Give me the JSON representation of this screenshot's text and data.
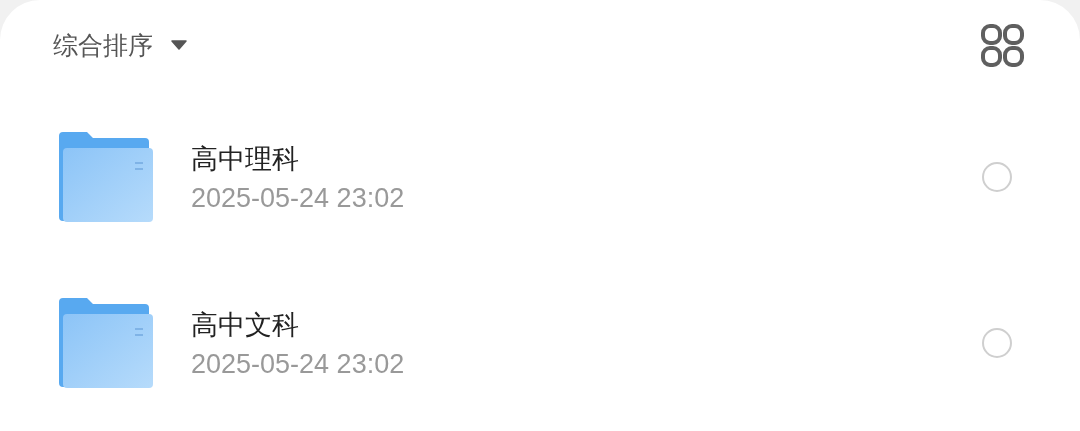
{
  "sort": {
    "label": "综合排序"
  },
  "files": [
    {
      "name": "高中理科",
      "modified": "2025-05-24 23:02",
      "selected": false
    },
    {
      "name": "高中文科",
      "modified": "2025-05-24 23:02",
      "selected": false
    }
  ]
}
